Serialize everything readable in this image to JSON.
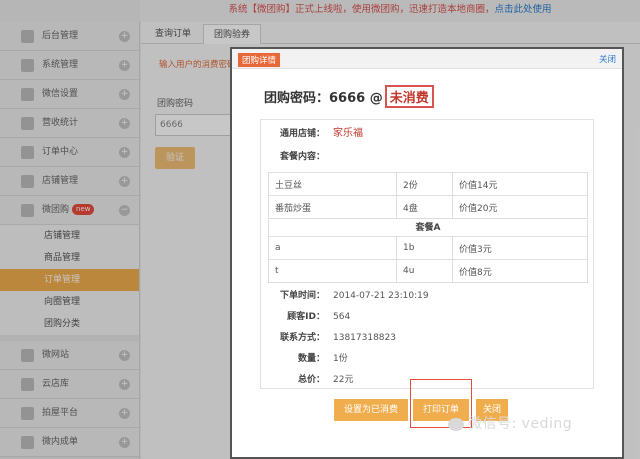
{
  "announcement": {
    "text": "系统【微团购】正式上线啦，使用微团购，迅速打造本地商圈，",
    "link": "点击此处使用"
  },
  "sidebar": {
    "items": [
      {
        "label": "后台管理"
      },
      {
        "label": "系统管理"
      },
      {
        "label": "微信设置"
      },
      {
        "label": "营收统计"
      },
      {
        "label": "订单中心"
      },
      {
        "label": "店铺管理"
      },
      {
        "label": "微团购",
        "badge": "new"
      }
    ],
    "subitems": [
      {
        "label": "店铺管理"
      },
      {
        "label": "商品管理"
      },
      {
        "label": "订单管理",
        "active": true
      },
      {
        "label": "向圈管理"
      },
      {
        "label": "团购分类"
      }
    ],
    "bottom_items": [
      {
        "label": "微网站"
      },
      {
        "label": "云店库"
      },
      {
        "label": "拍屋平台"
      },
      {
        "label": "微内成单"
      }
    ]
  },
  "tabs": [
    "查询订单",
    "团购验券"
  ],
  "form": {
    "hint": "输入用户的消费密码",
    "label": "团购密码",
    "value": "6666",
    "verify_button": "验证"
  },
  "modal": {
    "title": "团购详情",
    "close": "关闭",
    "code_label": "团购密码：6666 @",
    "status": "未消费",
    "shop_label": "通用店铺：",
    "shop_value": "家乐福",
    "package_label": "套餐内容：",
    "items_a": [
      {
        "name": "土豆丝",
        "qty": "2份",
        "price": "价值14元"
      },
      {
        "name": "番茄炒蛋",
        "qty": "4盘",
        "price": "价值20元"
      }
    ],
    "package_a_title": "套餐A",
    "items_b": [
      {
        "name": "a",
        "qty": "1b",
        "price": "价值3元"
      },
      {
        "name": "t",
        "qty": "4u",
        "price": "价值8元"
      }
    ],
    "details": [
      {
        "label": "下单时间：",
        "value": "2014-07-21 23:10:19"
      },
      {
        "label": "顾客ID：",
        "value": "564"
      },
      {
        "label": "联系方式：",
        "value": "13817318823"
      },
      {
        "label": "数量：",
        "value": "1份"
      },
      {
        "label": "总价：",
        "value": "22元"
      }
    ],
    "buttons": {
      "mark_consumed": "设置为已消费",
      "print": "打印订单",
      "close": "关闭"
    }
  },
  "watermark": "微信号: veding",
  "colors": {
    "accent": "#f0ad4e",
    "danger": "#d9534f",
    "link": "#2a7cd0"
  }
}
